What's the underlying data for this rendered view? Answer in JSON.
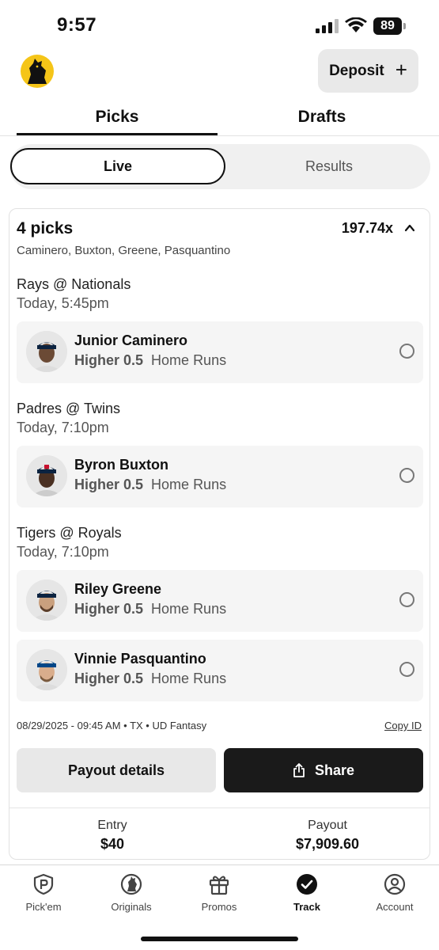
{
  "status_bar": {
    "time": "9:57",
    "battery": "89"
  },
  "header": {
    "deposit_label": "Deposit"
  },
  "tabs": [
    {
      "label": "Picks",
      "active": true
    },
    {
      "label": "Drafts",
      "active": false
    }
  ],
  "segment": {
    "live": "Live",
    "results": "Results"
  },
  "entry": {
    "picks_count": "4 picks",
    "multiplier": "197.74x",
    "players_summary": "Caminero, Buxton, Greene, Pasquantino",
    "games": [
      {
        "title": "Rays @ Nationals",
        "time": "Today, 5:45pm"
      },
      {
        "title": "Padres @ Twins",
        "time": "Today, 7:10pm"
      },
      {
        "title": "Tigers @ Royals",
        "time": "Today, 7:10pm"
      }
    ],
    "picks": [
      {
        "player": "Junior Caminero",
        "direction": "Higher 0.5",
        "stat": "Home Runs",
        "cap_color": "#0c2340"
      },
      {
        "player": "Byron Buxton",
        "direction": "Higher 0.5",
        "stat": "Home Runs",
        "cap_color": "#0c2340"
      },
      {
        "player": "Riley Greene",
        "direction": "Higher 0.5",
        "stat": "Home Runs",
        "cap_color": "#0c2340"
      },
      {
        "player": "Vinnie Pasquantino",
        "direction": "Higher 0.5",
        "stat": "Home Runs",
        "cap_color": "#004687"
      }
    ],
    "meta": "08/29/2025 - 09:45 AM • TX • UD Fantasy",
    "copy_id": "Copy ID",
    "payout_details": "Payout details",
    "share": "Share",
    "entry_label": "Entry",
    "entry_value": "$40",
    "payout_label": "Payout",
    "payout_value": "$7,909.60"
  },
  "bottom_nav": [
    {
      "label": "Pick'em",
      "icon": "pickem-icon"
    },
    {
      "label": "Originals",
      "icon": "originals-icon"
    },
    {
      "label": "Promos",
      "icon": "gift-icon"
    },
    {
      "label": "Track",
      "icon": "check-circle-icon",
      "active": true
    },
    {
      "label": "Account",
      "icon": "account-icon"
    }
  ],
  "colors": {
    "accent": "#111111",
    "logo_yellow": "#f5c518"
  }
}
